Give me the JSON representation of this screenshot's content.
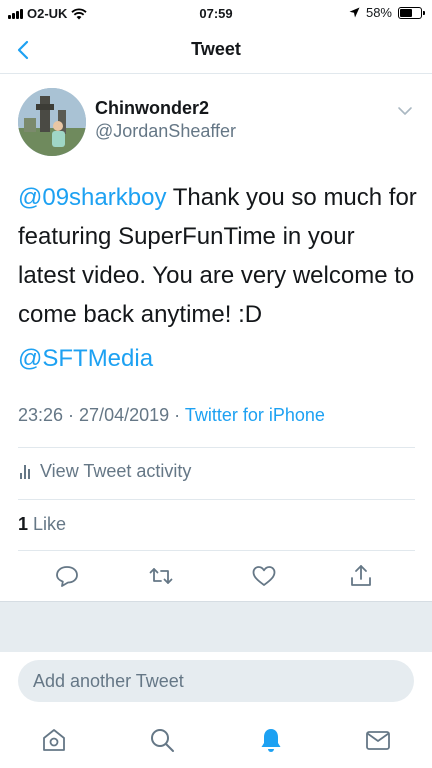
{
  "status_bar": {
    "carrier": "O2-UK",
    "time": "07:59",
    "battery": "58%"
  },
  "nav": {
    "title": "Tweet"
  },
  "tweet": {
    "display_name": "Chinwonder2",
    "handle": "@JordanSheaffer",
    "mention": "@09sharkboy",
    "body": " Thank you so much for featuring SuperFunTime in your latest video. You are very welcome to come back anytime! :D",
    "mention2": "@SFTMedia",
    "timestamp": "23:26 · 27/04/2019 · ",
    "source": "Twitter for iPhone"
  },
  "activity": {
    "label": "View Tweet activity"
  },
  "likes": {
    "count": "1",
    "label": " Like"
  },
  "reply": {
    "placeholder": "Add another Tweet"
  },
  "colors": {
    "accent": "#1da1f2",
    "secondary_text": "#657786",
    "divider": "#e1e8ed"
  },
  "icons": {
    "actions": [
      "reply-icon",
      "retweet-icon",
      "like-icon",
      "share-icon"
    ],
    "tabs": [
      "home-icon",
      "search-icon",
      "notifications-icon",
      "messages-icon"
    ]
  }
}
